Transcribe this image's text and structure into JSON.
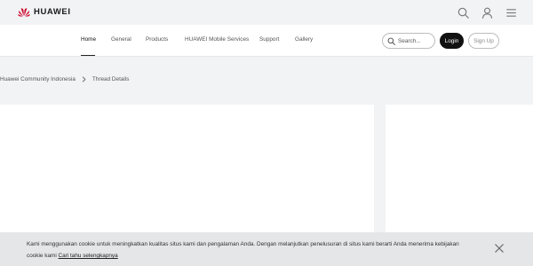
{
  "brand": {
    "name": "HUAWEI",
    "color": "#cf0a2c"
  },
  "top_icons": [
    "search-icon",
    "user-icon",
    "menu-icon"
  ],
  "nav": {
    "items": [
      {
        "label": "Home",
        "active": true
      },
      {
        "label": "General",
        "active": false
      },
      {
        "label": "Products",
        "active": false
      },
      {
        "label": "HUAWEI Mobile Services",
        "active": false
      },
      {
        "label": "Support",
        "active": false
      },
      {
        "label": "Gallery",
        "active": false
      }
    ],
    "search_placeholder": "Search...",
    "login_label": "Login",
    "signup_label": "Sign Up"
  },
  "breadcrumb": [
    "Huawei Community Indonesia",
    "Thread Details"
  ],
  "cookie": {
    "text": "Kami menggunakan cookie untuk meningkatkan kualitas situs kami dan pengalaman Anda. Dengan melanjutkan penelusuran di situs kami berarti Anda menerima kebijakan cookie kami",
    "link_text": "Cari tahu selengkapnya"
  }
}
